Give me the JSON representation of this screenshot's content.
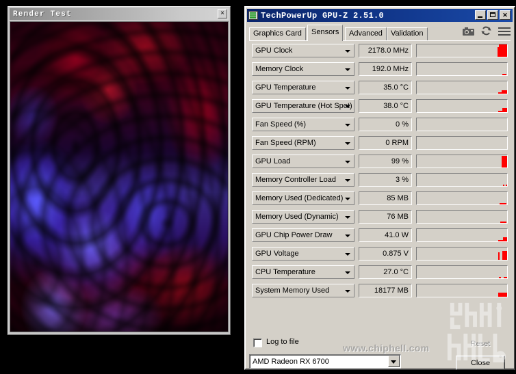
{
  "render_window": {
    "title": "Render Test",
    "close_label": "×"
  },
  "gpuz": {
    "title": "TechPowerUp GPU-Z 2.51.0",
    "window_buttons": {
      "minimize": "_",
      "maximize": "□",
      "close": "✕"
    },
    "tabs": [
      {
        "label": "Graphics Card",
        "active": false
      },
      {
        "label": "Sensors",
        "active": true
      },
      {
        "label": "Advanced",
        "active": false
      },
      {
        "label": "Validation",
        "active": false
      }
    ],
    "toolbar_icons": [
      {
        "name": "camera-icon"
      },
      {
        "name": "refresh-icon"
      },
      {
        "name": "menu-icon"
      }
    ],
    "sensors": [
      {
        "name": "GPU Clock",
        "value": "2178.0 MHz",
        "trace_height": 18,
        "trace_width": 12
      },
      {
        "name": "Memory Clock",
        "value": "192.0 MHz",
        "trace_height": 2,
        "trace_width": 6
      },
      {
        "name": "GPU Temperature",
        "value": "35.0 °C",
        "trace_height": 4,
        "trace_width": 13
      },
      {
        "name": "GPU Temperature (Hot Spot)",
        "value": "38.0 °C",
        "trace_height": 5,
        "trace_width": 12
      },
      {
        "name": "Fan Speed (%)",
        "value": "0 %",
        "trace_height": 0,
        "trace_width": 0
      },
      {
        "name": "Fan Speed (RPM)",
        "value": "0 RPM",
        "trace_height": 0,
        "trace_width": 0
      },
      {
        "name": "GPU Load",
        "value": "99 %",
        "trace_height": 17,
        "trace_width": 8
      },
      {
        "name": "Memory Controller Load",
        "value": "3 %",
        "trace_height": 2,
        "trace_width": 5
      },
      {
        "name": "Memory Used (Dedicated)",
        "value": "85 MB",
        "trace_height": 2,
        "trace_width": 10
      },
      {
        "name": "Memory Used (Dynamic)",
        "value": "76 MB",
        "trace_height": 2,
        "trace_width": 9
      },
      {
        "name": "GPU Chip Power Draw",
        "value": "41.0 W",
        "trace_height": 5,
        "trace_width": 12
      },
      {
        "name": "GPU Voltage",
        "value": "0.875 V",
        "trace_height": 13,
        "trace_width": 9
      },
      {
        "name": "CPU Temperature",
        "value": "27.0 °C",
        "trace_height": 2,
        "trace_width": 11
      },
      {
        "name": "System Memory Used",
        "value": "18177 MB",
        "trace_height": 6,
        "trace_width": 13
      }
    ],
    "log_to_file": {
      "label": "Log to file",
      "checked": false
    },
    "reset_button": "Reset",
    "close_button": "Close",
    "gpu_selector": {
      "value": "AMD Radeon RX 6700"
    }
  },
  "watermark": {
    "url": "www.chiphell.com",
    "logo_name": "chiphell-logo"
  },
  "colors": {
    "titlebar_blue": "#0a246a",
    "window_face": "#d4d0c8",
    "trace_red": "#ff0000"
  }
}
